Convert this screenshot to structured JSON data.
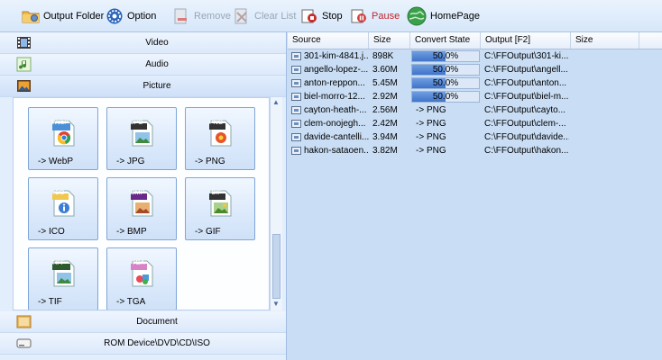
{
  "toolbar": {
    "output_folder": "Output Folder",
    "option": "Option",
    "remove": "Remove",
    "clear_list": "Clear List",
    "stop": "Stop",
    "pause": "Pause",
    "homepage": "HomePage"
  },
  "categories": {
    "video": "Video",
    "audio": "Audio",
    "picture": "Picture",
    "document": "Document",
    "rom": "ROM Device\\DVD\\CD\\ISO"
  },
  "formats": [
    {
      "badge": "WebP",
      "label": "-> WebP"
    },
    {
      "badge": "JPG",
      "label": "-> JPG"
    },
    {
      "badge": "PNG",
      "label": "-> PNG"
    },
    {
      "badge": "ICO",
      "label": "-> ICO"
    },
    {
      "badge": "BMP",
      "label": "-> BMP"
    },
    {
      "badge": "GIF",
      "label": "-> GIF"
    },
    {
      "badge": "TIFF",
      "label": "-> TIF"
    },
    {
      "badge": "TGA",
      "label": "-> TGA"
    }
  ],
  "table": {
    "columns": [
      "Source",
      "Size",
      "Convert State",
      "Output [F2]",
      "Size"
    ],
    "rows": [
      {
        "source": "301-kim-4841.j...",
        "size": "898K",
        "state": "50.0%",
        "progress": 0.5,
        "output": "C:\\FFOutput\\301-ki..."
      },
      {
        "source": "angello-lopez-...",
        "size": "3.60M",
        "state": "50.0%",
        "progress": 0.5,
        "output": "C:\\FFOutput\\angell..."
      },
      {
        "source": "anton-reppon...",
        "size": "5.45M",
        "state": "50.0%",
        "progress": 0.5,
        "output": "C:\\FFOutput\\anton..."
      },
      {
        "source": "biel-morro-12...",
        "size": "2.92M",
        "state": "50.0%",
        "progress": 0.5,
        "output": "C:\\FFOutput\\biel-m..."
      },
      {
        "source": "cayton-heath-...",
        "size": "2.56M",
        "state": "-> PNG",
        "progress": null,
        "output": "C:\\FFOutput\\cayto..."
      },
      {
        "source": "clem-onojegh...",
        "size": "2.42M",
        "state": "-> PNG",
        "progress": null,
        "output": "C:\\FFOutput\\clem-..."
      },
      {
        "source": "davide-cantelli...",
        "size": "3.94M",
        "state": "-> PNG",
        "progress": null,
        "output": "C:\\FFOutput\\davide..."
      },
      {
        "source": "hakon-sataoen...",
        "size": "3.82M",
        "state": "-> PNG",
        "progress": null,
        "output": "C:\\FFOutput\\hakon..."
      }
    ]
  },
  "colors": {
    "accent": "#3f74c9",
    "pause_text": "#c0262d",
    "panel": "#c9def5"
  }
}
